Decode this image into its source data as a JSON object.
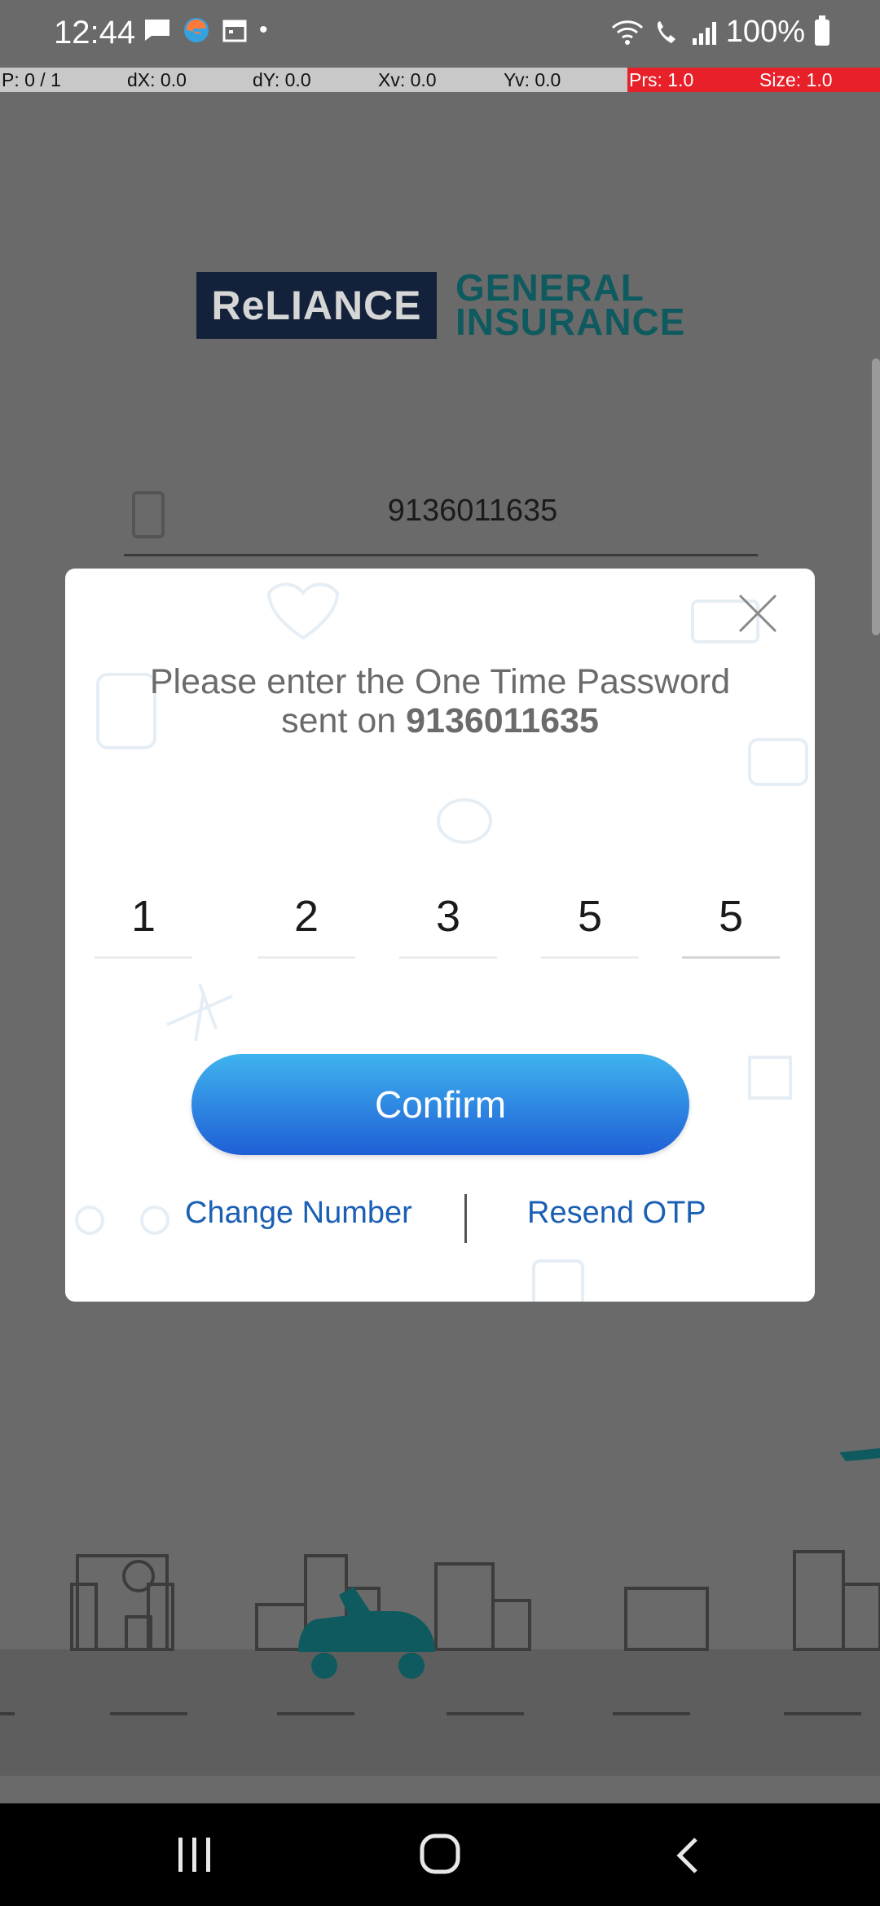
{
  "status_bar": {
    "time": "12:44",
    "battery": "100%",
    "left_icons": [
      "chat-icon",
      "edge-browser-icon",
      "calendar-icon",
      "dot-icon"
    ],
    "right_icons": [
      "wifi-icon",
      "wifi-call-icon",
      "signal-icon",
      "battery-icon"
    ]
  },
  "debug_bar": {
    "pointer": "P: 0 / 1",
    "dx": "dX: 0.0",
    "dy": "dY: 0.0",
    "xv": "Xv: 0.0",
    "yv": "Yv: 0.0",
    "prs": "Prs: 1.0",
    "size": "Size: 1.0",
    "highlight_color": "#e8202a"
  },
  "background": {
    "logo_brand": "ReLIANCE",
    "logo_line1": "GENERAL",
    "logo_line2": "INSURANCE",
    "phone_value": "9136011635"
  },
  "modal": {
    "message_line1": "Please enter the One Time Password",
    "message_prefix": "sent on ",
    "message_number": "9136011635",
    "otp_digits": [
      "1",
      "2",
      "3",
      "5",
      "5"
    ],
    "confirm_label": "Confirm",
    "change_number_label": "Change Number",
    "resend_otp_label": "Resend OTP",
    "accent_color": "#1a5fb4"
  },
  "nav_bar": {
    "buttons": [
      "recents-icon",
      "home-icon",
      "back-icon"
    ]
  }
}
